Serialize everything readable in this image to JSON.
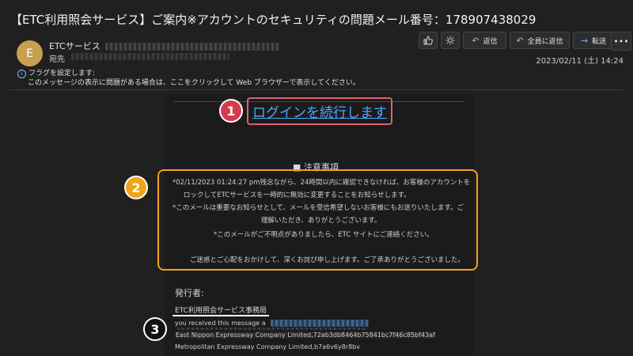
{
  "header": {
    "subject": "【ETC利用照会サービス】ご案内※アカウントのセキュリティの問題メール番号：178907438029",
    "avatar_letter": "E",
    "sender_name": "ETCサービス",
    "to_label": "宛先",
    "date": "2023/02/11 (土) 14:24"
  },
  "toolbar": {
    "like_icon": "thumbs-up-icon",
    "brightness_icon": "sun-icon",
    "reply": "返信",
    "reply_all": "全員に返信",
    "forward": "転送",
    "more": "•••"
  },
  "info_bar": {
    "line1": "フラグを設定します:",
    "line2": "このメッセージの表示に問題がある場合は、ここをクリックして Web ブラウザーで表示してください。"
  },
  "callouts": {
    "one": "1",
    "two": "2",
    "three": "3"
  },
  "body": {
    "login_link": "ログインを続行します",
    "notice_title": "■ 注意事項",
    "notice_lines": [
      "*02/11/2023 01:24:27 pm残念ながら、24時間以内に確認できなければ、お客様のアカウントを",
      "ロックしてETCサービスを一時的に無効に変更することをお知らせします。",
      "*このメールは重要なお知らせとして、メールを受信希望しないお客様にもお送りいたします。ご",
      "理解いただき、ありがとうございます。",
      "*このメールがご不明点がありましたら、ETC サイトにご連絡ください。",
      "ご迷惑とご心配をおかけして、深くお詫び申し上げます。ご了承ありがとうございました。"
    ],
    "publisher_heading": "発行者:",
    "publisher_org": "ETC利用照会サービス事務局",
    "received_text": "you received this message a",
    "east_line": "East Nippon Expressway Company Limited,72ab3db8464b75841bc7f46c85bf43af",
    "metro_line": "Metropolitan Expressway Company Limited,b7a6v6y8r8bv"
  },
  "colors": {
    "callout1": "#d93a4b",
    "callout2": "#f2a31b",
    "callout3": "#111111",
    "link": "#4fa6ff",
    "background": "#202020"
  }
}
